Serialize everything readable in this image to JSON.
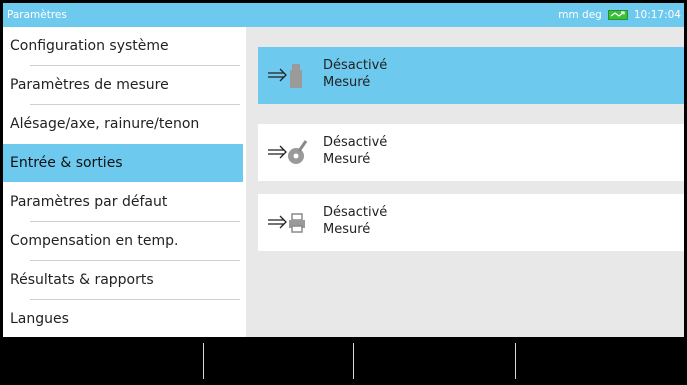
{
  "titlebar": {
    "title": "Paramètres",
    "units": "mm deg",
    "time": "10:17:04",
    "battery_icon": "battery-charging-icon",
    "accent_color": "#6ec9ee"
  },
  "sidebar": {
    "items": [
      {
        "label": "Configuration système",
        "selected": false
      },
      {
        "label": "Paramètres de mesure",
        "selected": false
      },
      {
        "label": "Alésage/axe, rainure/tenon",
        "selected": false
      },
      {
        "label": "Entrée & sorties",
        "selected": true
      },
      {
        "label": "Paramètres par défaut",
        "selected": false
      },
      {
        "label": "Compensation en temp.",
        "selected": false
      },
      {
        "label": "Résultats & rapports",
        "selected": false
      },
      {
        "label": "Langues",
        "selected": false
      }
    ]
  },
  "main": {
    "cards": [
      {
        "icon": "usb-drive-icon",
        "status": "Désactivé",
        "mode": "Mesuré",
        "selected": true
      },
      {
        "icon": "wireless-probe-icon",
        "status": "Désactivé",
        "mode": "Mesuré",
        "selected": false
      },
      {
        "icon": "printer-icon",
        "status": "Désactivé",
        "mode": "Mesuré",
        "selected": false
      }
    ]
  },
  "softkeys": {
    "count": 4
  }
}
